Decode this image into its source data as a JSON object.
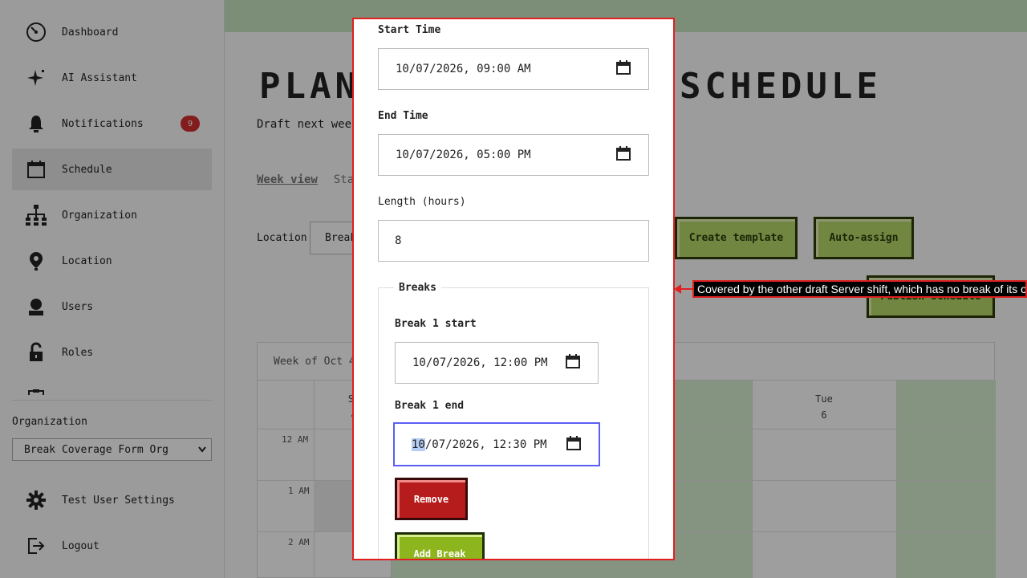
{
  "sidebar": {
    "items": [
      {
        "label": "Dashboard",
        "icon": "dashboard-icon"
      },
      {
        "label": "AI Assistant",
        "icon": "sparkle-icon"
      },
      {
        "label": "Notifications",
        "icon": "bell-icon",
        "badge": "9"
      },
      {
        "label": "Schedule",
        "icon": "calendar-icon",
        "active": true
      },
      {
        "label": "Organization",
        "icon": "org-chart-icon"
      },
      {
        "label": "Location",
        "icon": "map-pin-icon"
      },
      {
        "label": "Users",
        "icon": "user-icon"
      },
      {
        "label": "Roles",
        "icon": "lock-icon"
      }
    ],
    "org_label": "Organization",
    "org_select": "Break Coverage Form Org",
    "settings_label": "Test User Settings",
    "logout_label": "Logout"
  },
  "main": {
    "title": "PLAN",
    "title_right": "SCHEDULE",
    "subtitle": "Draft next week",
    "tabs": [
      {
        "label": "Week view",
        "active": true
      },
      {
        "label": "Staf",
        "active": false
      }
    ],
    "location_label": "Location",
    "location_value": "Break",
    "create_template": "Create template",
    "auto_assign": "Auto-assign",
    "publish": "Publish schedule",
    "week_header": "Week of Oct 4",
    "days": [
      {
        "name": "Su",
        "num": "4"
      },
      {
        "name": "Tue",
        "num": "6"
      }
    ],
    "hours": [
      "12 AM",
      "1 AM",
      "2 AM"
    ]
  },
  "modal": {
    "start_label": "Start Time",
    "start_value": "10/07/2026, 09:00 AM",
    "end_label": "End Time",
    "end_value": "10/07/2026, 05:00 PM",
    "length_label": "Length (hours)",
    "length_value": "8",
    "breaks_legend": "Breaks",
    "break1_start_label": "Break 1 start",
    "break1_start_value": "10/07/2026, 12:00 PM",
    "break1_end_label": "Break 1 end",
    "break1_end_month": "10",
    "break1_end_rest": "/07/2026, 12:30 PM",
    "remove_label": "Remove",
    "add_break_label": "Add Break"
  },
  "callout": {
    "text": "Covered by the other draft Server shift, which has no break of its own."
  },
  "colors": {
    "accent_red": "#e02020",
    "button_green": "#b6d96a",
    "remove_red": "#b71c1c",
    "add_green": "#8db51e",
    "focus_blue": "#5b5ef5"
  }
}
